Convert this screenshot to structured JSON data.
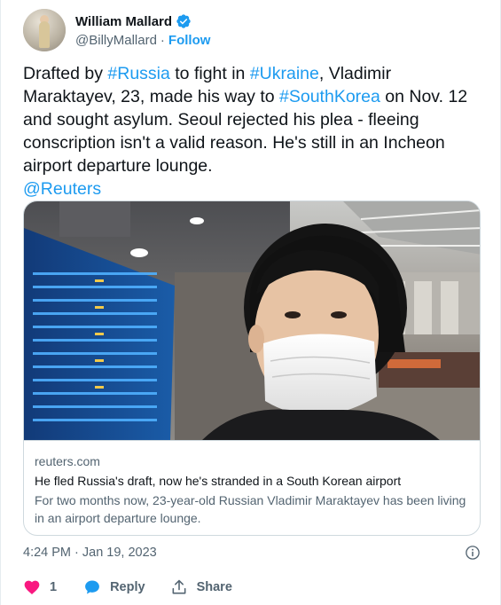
{
  "author": {
    "display_name": "William Mallard",
    "handle": "@BillyMallard",
    "separator": "·",
    "follow_label": "Follow"
  },
  "tweet": {
    "segments": [
      {
        "text": "Drafted by ",
        "tag": false
      },
      {
        "text": "#Russia",
        "tag": true
      },
      {
        "text": " to fight in ",
        "tag": false
      },
      {
        "text": "#Ukraine",
        "tag": true
      },
      {
        "text": ", Vladimir Maraktayev, 23, made his way to ",
        "tag": false
      },
      {
        "text": "#SouthKorea",
        "tag": true
      },
      {
        "text": " on Nov. 12 and sought asylum. Seoul rejected his plea - fleeing conscription isn't a valid reason. He's still in an Incheon airport departure lounge.",
        "tag": false
      }
    ],
    "mention": "@Reuters"
  },
  "card": {
    "domain": "reuters.com",
    "title": "He fled Russia's draft, now he's stranded in a South Korean airport",
    "description": "For two months now, 23-year-old Russian Vladimir Maraktayev has been living in an airport departure lounge.",
    "image_icon": "airport-selfie-photo"
  },
  "timestamp": "4:24 PM · Jan 19, 2023",
  "actions": {
    "like_count": "1",
    "reply_label": "Reply",
    "share_label": "Share"
  },
  "colors": {
    "accent": "#1d9bf0",
    "like": "#f91880",
    "muted": "#536471"
  }
}
